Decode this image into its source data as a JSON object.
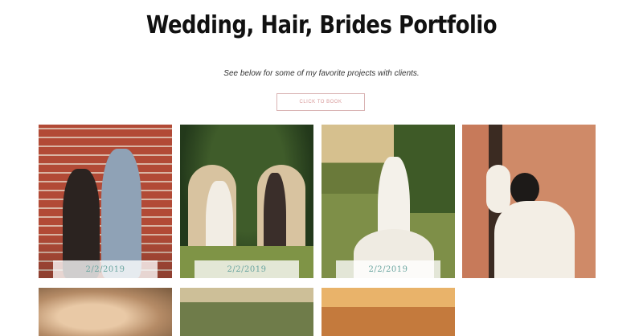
{
  "page": {
    "title": "Wedding, Hair, Brides Portfolio",
    "subtitle": "See below for some of my favorite projects with clients.",
    "cta_label": "CLICK TO BOOK"
  },
  "portfolio": {
    "tiles": [
      {
        "date": "2/2/2019"
      },
      {
        "date": "2/2/2019"
      },
      {
        "date": "2/2/2019"
      },
      {
        "date": ""
      },
      {
        "date": ""
      },
      {
        "date": ""
      },
      {
        "date": ""
      }
    ]
  },
  "colors": {
    "cta_border": "#d9b3b3",
    "cta_text": "#d89a9a",
    "date_text": "#6aa5a0"
  }
}
